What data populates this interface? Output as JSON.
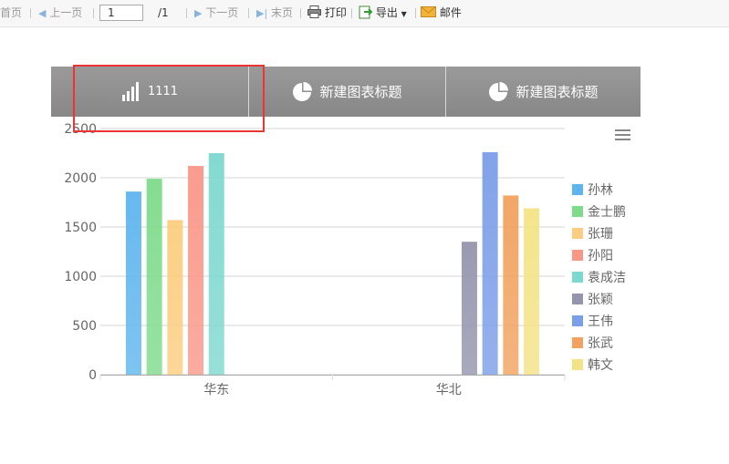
{
  "toolbar": {
    "first": "首页",
    "prev": "上一页",
    "page_value": "1",
    "page_total": "/1",
    "next": "下一页",
    "last": "末页",
    "print": "打印",
    "export": "导出",
    "mail": "邮件"
  },
  "tabs": [
    {
      "label": "1111",
      "icon": "bar-chart-icon"
    },
    {
      "label": "新建图表标题",
      "icon": "pie-chart-icon"
    },
    {
      "label": "新建图表标题",
      "icon": "pie-chart-icon"
    }
  ],
  "colors": {
    "tab_bg": "#8e8e8e",
    "highlight": "#ee3333"
  },
  "chart_data": {
    "type": "bar",
    "categories": [
      "华东",
      "华北"
    ],
    "ylim": [
      0,
      2500
    ],
    "yticks": [
      0,
      500,
      1000,
      1500,
      2000,
      2500
    ],
    "grid": true,
    "legend_position": "right",
    "series": [
      {
        "name": "孙林",
        "color": "#5eb5ee",
        "values": [
          1860,
          null
        ]
      },
      {
        "name": "金士鹏",
        "color": "#7ddb8a",
        "values": [
          1990,
          null
        ]
      },
      {
        "name": "张珊",
        "color": "#fccd7e",
        "values": [
          1570,
          null
        ]
      },
      {
        "name": "孙阳",
        "color": "#f99787",
        "values": [
          2120,
          null
        ]
      },
      {
        "name": "袁成洁",
        "color": "#7dd8cf",
        "values": [
          2250,
          null
        ]
      },
      {
        "name": "张颖",
        "color": "#9494ad",
        "values": [
          null,
          1350
        ]
      },
      {
        "name": "王伟",
        "color": "#7b9ee8",
        "values": [
          null,
          2260
        ]
      },
      {
        "name": "张武",
        "color": "#f1a25e",
        "values": [
          null,
          1820
        ]
      },
      {
        "name": "韩文",
        "color": "#f3e386",
        "values": [
          null,
          1690
        ]
      }
    ]
  }
}
